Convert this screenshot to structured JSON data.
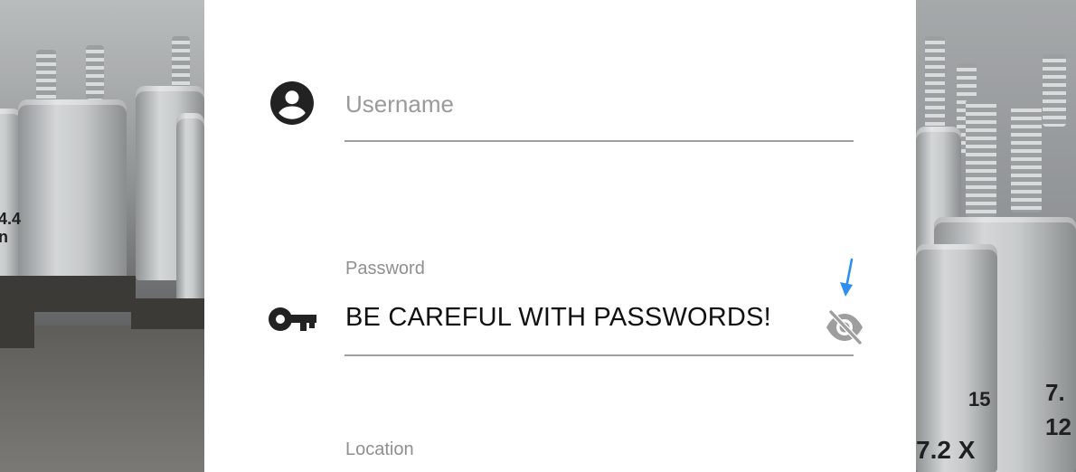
{
  "form": {
    "username": {
      "placeholder": "Username",
      "icon": "account-circle-icon"
    },
    "password": {
      "label": "Password",
      "value": "BE CAREFUL WITH PASSWORDS!",
      "icon": "key-icon",
      "toggle_icon": "eye-off-icon",
      "visible": true
    },
    "location": {
      "label": "Location"
    }
  },
  "annotation": {
    "arrow_color": "#2f8ff0"
  },
  "background": {
    "left_stencils": [
      "4.4",
      "n"
    ],
    "right_stencils": [
      "15",
      "7.",
      "12",
      "7.2 X"
    ]
  },
  "colors": {
    "panel": "#ffffff",
    "text": "#111111",
    "hint": "#9a9a9a",
    "underline": "#9e9e9e"
  }
}
